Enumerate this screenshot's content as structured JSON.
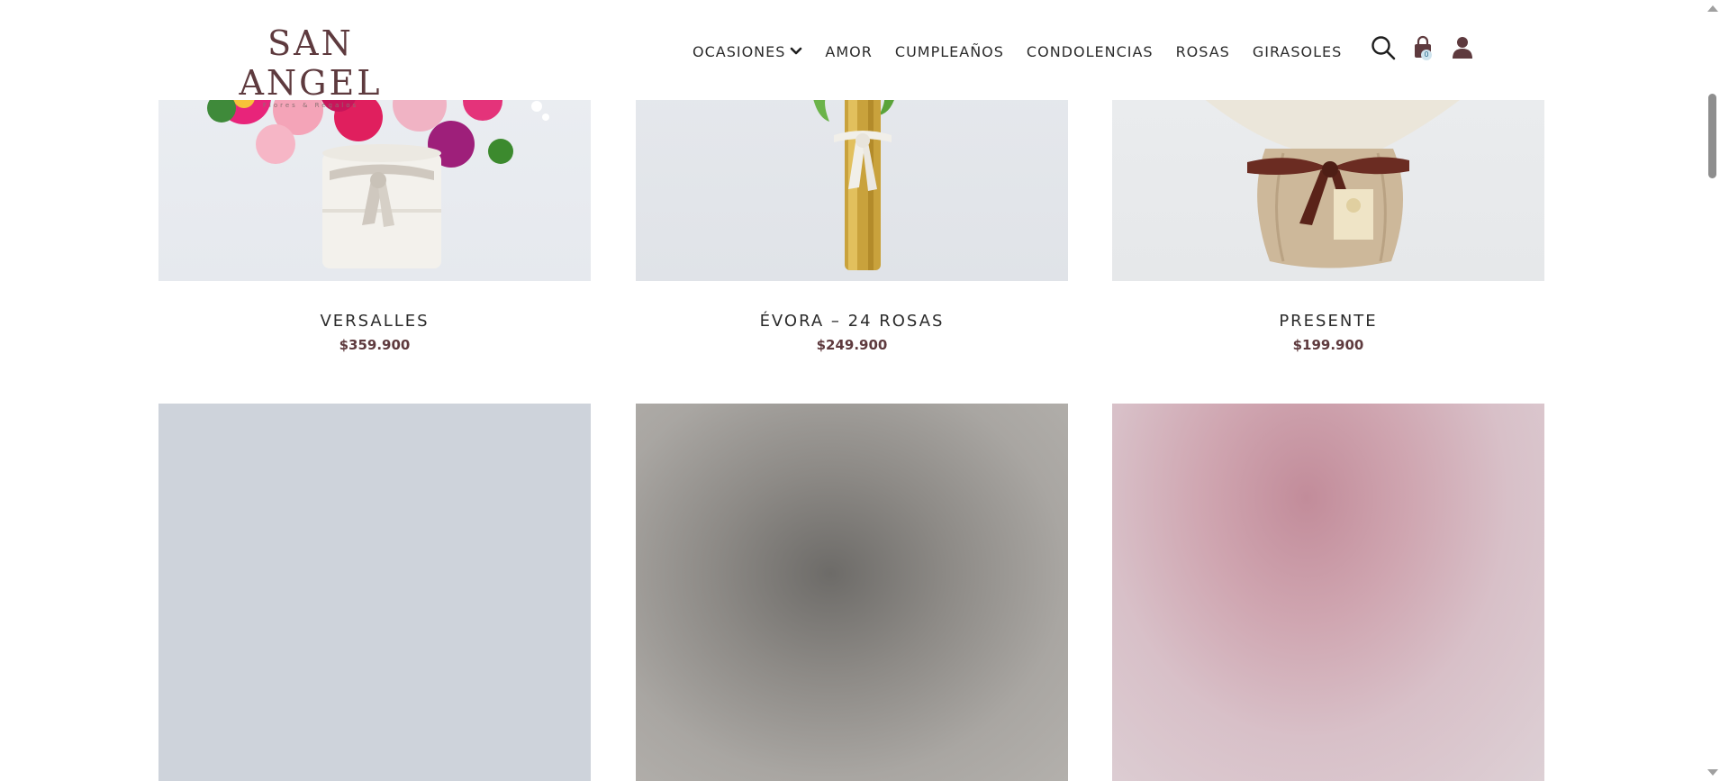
{
  "brand": {
    "name": "SAN ANGEL",
    "tagline": "Flores & Regalos",
    "color": "#5e3a3e"
  },
  "nav": {
    "items": [
      {
        "label": "OCASIONES",
        "has_dropdown": true
      },
      {
        "label": "AMOR"
      },
      {
        "label": "CUMPLEAÑOS"
      },
      {
        "label": "CONDOLENCIAS"
      },
      {
        "label": "ROSAS"
      },
      {
        "label": "GIRASOLES"
      }
    ]
  },
  "header_icons": {
    "search": "search-icon",
    "cart": "shopping-bag-icon",
    "cart_count": "0",
    "account": "user-icon"
  },
  "products": [
    {
      "title": "VERSALLES",
      "price": "$359.900"
    },
    {
      "title": "ÉVORA – 24 ROSAS",
      "price": "$249.900"
    },
    {
      "title": "PRESENTE",
      "price": "$199.900"
    }
  ]
}
